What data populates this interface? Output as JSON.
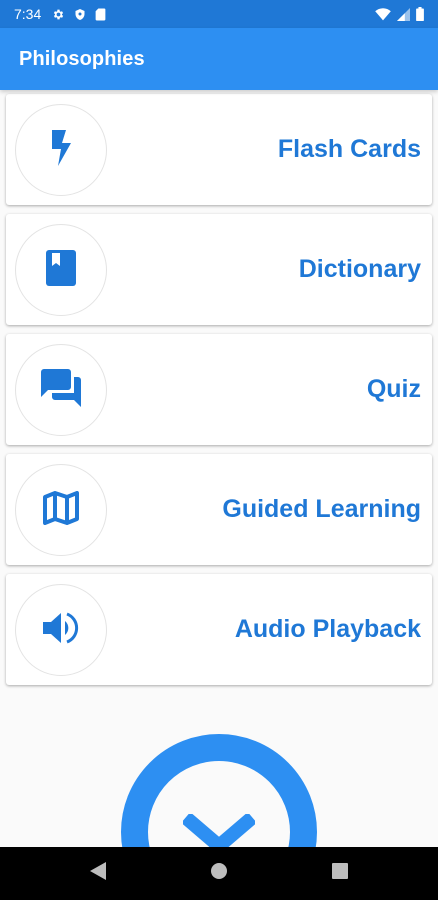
{
  "status_bar": {
    "time": "7:34",
    "icons": [
      "gear-icon",
      "shield-icon",
      "sd-card-icon",
      "wifi-icon",
      "signal-icon",
      "battery-icon"
    ]
  },
  "app_bar": {
    "title": "Philosophies"
  },
  "menu": {
    "items": [
      {
        "label": "Flash Cards",
        "icon": "flash-icon"
      },
      {
        "label": "Dictionary",
        "icon": "book-icon"
      },
      {
        "label": "Quiz",
        "icon": "chat-bubbles-icon"
      },
      {
        "label": "Guided Learning",
        "icon": "map-icon"
      },
      {
        "label": "Audio Playback",
        "icon": "speaker-icon"
      }
    ]
  },
  "colors": {
    "primary": "#2d8ff2",
    "primary_dark": "#1f78d6",
    "label": "#1f78d6",
    "background": "#fafafa"
  },
  "nav_bar": {
    "buttons": [
      "back-icon",
      "home-icon",
      "recents-icon"
    ]
  }
}
